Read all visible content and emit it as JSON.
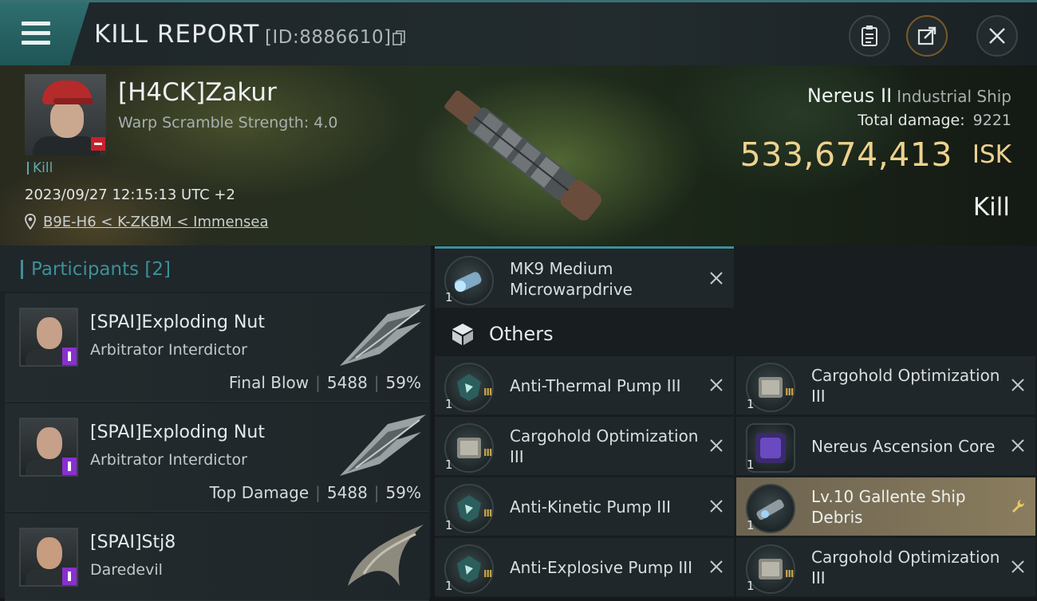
{
  "header": {
    "title": "KILL REPORT",
    "report_id": "[ID:8886610]"
  },
  "victim": {
    "name": "[H4CK]Zakur",
    "scramble": "Warp Scramble Strength: 4.0",
    "tag": "Kill",
    "datetime": "2023/09/27 12:15:13 UTC +2",
    "location": "B9E-H6 < K-ZKBM < Immensea",
    "ship": "Nereus II",
    "ship_type": "Industrial Ship",
    "total_damage_label": "Total damage:",
    "total_damage": "9221",
    "isk_value": "533,674,413",
    "isk_unit": "ISK",
    "result": "Kill"
  },
  "participants": {
    "title": "Participants [2]",
    "rows": [
      {
        "name": "[SPAI]Exploding Nut",
        "ship": "Arbitrator Interdictor",
        "role": "Final Blow",
        "damage": "5488",
        "percent": "59%"
      },
      {
        "name": "[SPAI]Exploding Nut",
        "ship": "Arbitrator Interdictor",
        "role": "Top Damage",
        "damage": "5488",
        "percent": "59%"
      },
      {
        "name": "[SPAI]Stj8",
        "ship": "Daredevil"
      }
    ]
  },
  "items": {
    "top": {
      "label": "MK9 Medium Microwarpdrive",
      "qty": "1"
    },
    "others_title": "Others",
    "left": [
      {
        "label": "Anti-Thermal Pump III",
        "qty": "1",
        "tier": "III"
      },
      {
        "label": "Cargohold Optimization III",
        "qty": "1",
        "tier": "III"
      },
      {
        "label": "Anti-Kinetic Pump III",
        "qty": "1",
        "tier": "III"
      },
      {
        "label": "Anti-Explosive Pump III",
        "qty": "1",
        "tier": "III"
      }
    ],
    "right": [
      {
        "label": "Cargohold Optimization III",
        "qty": "1",
        "tier": "III"
      },
      {
        "label": "Nereus Ascension Core",
        "qty": "1"
      },
      {
        "label": "Lv.10 Gallente Ship Debris",
        "qty": "1"
      },
      {
        "label": "Cargohold Optimization III",
        "qty": "1",
        "tier": "III"
      }
    ]
  },
  "colors": {
    "accent": "#3f8f98",
    "isk": "#eed28e",
    "highlight_item": "#8a7d5e"
  }
}
